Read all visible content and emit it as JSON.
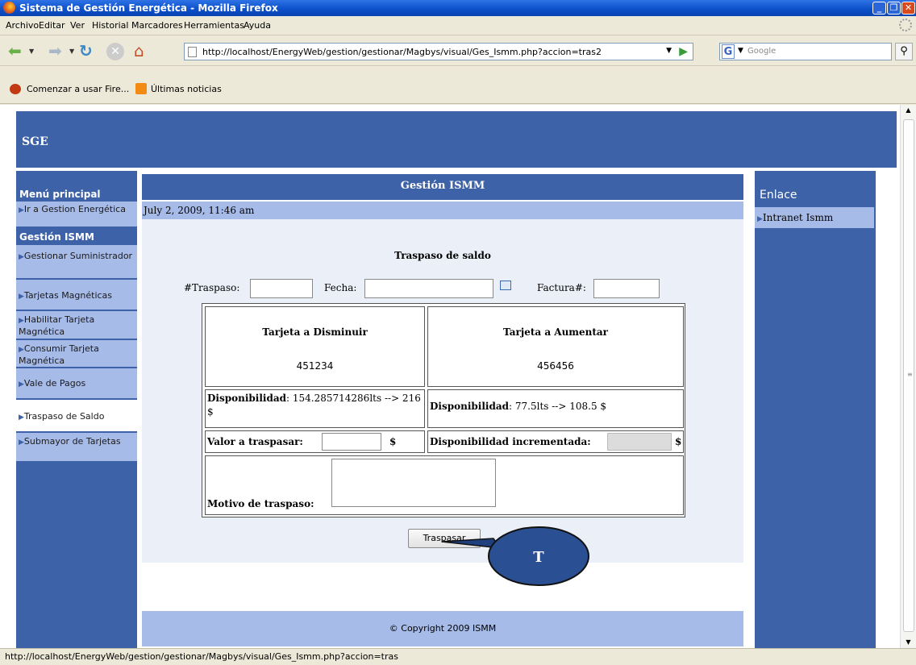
{
  "window": {
    "title": "Sistema de Gestión Energética - Mozilla Firefox"
  },
  "menu": [
    "Archivo",
    "Editar",
    "Ver",
    "Historial",
    "Marcadores",
    "Herramientas",
    "Ayuda"
  ],
  "nav": {
    "url": "http://localhost/EnergyWeb/gestion/gestionar/Magbys/visual/Ges_Ismm.php?accion=tras2",
    "search_placeholder": "Google"
  },
  "bookmarks": [
    "Comenzar a usar Fire...",
    "Últimas noticias"
  ],
  "page": {
    "brand": "SGE",
    "left_nav": {
      "heading_main": "Menú principal",
      "item_ir": "Ir a Gestion Energética",
      "heading_section": "Gestión ISMM",
      "items": [
        "Gestionar Suministrador",
        "Tarjetas Magnéticas",
        "Habilitar Tarjeta Magnética",
        "Consumir Tarjeta Magnética",
        "Vale de Pagos",
        "Traspaso de Saldo",
        "Submayor de Tarjetas"
      ]
    },
    "center": {
      "title": "Gestión ISMM",
      "date": "July 2, 2009, 11:46 am",
      "form_title": "Traspaso de saldo",
      "label_traspaso": "#Traspaso:",
      "label_fecha": "Fecha:",
      "label_factura": "Factura#:",
      "card_from_label": "Tarjeta a Disminuir",
      "card_from_value": "451234",
      "card_to_label": "Tarjeta a Aumentar",
      "card_to_value": "456456",
      "disp_label": "Disponibilidad",
      "disp_from": ": 154.285714286lts --> 216 $",
      "disp_to": ": 77.5lts --> 108.5 $",
      "valor_label": "Valor a traspasar:",
      "dollar": "$",
      "disp_inc_label": "Disponibilidad incrementada:",
      "motivo_label": "Motivo de traspaso:",
      "submit_label": "Traspasar",
      "footer": "© Copyright 2009 ISMM"
    },
    "right_nav": {
      "heading": "Enlace",
      "link": "Intranet Ismm"
    }
  },
  "annotation": {
    "label": "T"
  },
  "status": "http://localhost/EnergyWeb/gestion/gestionar/Magbys/visual/Ges_Ismm.php?accion=tras"
}
